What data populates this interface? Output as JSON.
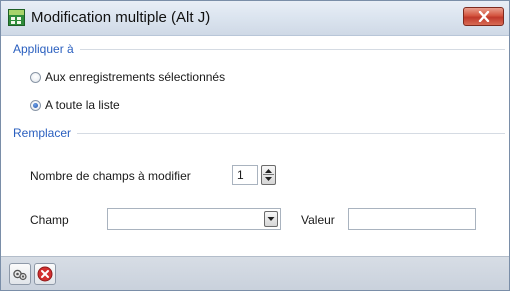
{
  "window": {
    "title": "Modification multiple (Alt J)"
  },
  "apply_group": {
    "title": "Appliquer à",
    "options": [
      {
        "label": "Aux enregistrements sélectionnés",
        "checked": false
      },
      {
        "label": "A toute la liste",
        "checked": true
      }
    ]
  },
  "replace_group": {
    "title": "Remplacer",
    "field_count_label": "Nombre de champs à modifier",
    "field_count_value": "1",
    "champ_label": "Champ",
    "champ_value": "",
    "valeur_label": "Valeur",
    "valeur_value": ""
  },
  "footer": {
    "buttons": [
      {
        "icon": "run-icon"
      },
      {
        "icon": "cancel-icon"
      }
    ]
  },
  "colors": {
    "group_title": "#2a5fbf",
    "close_button": "#c0392b",
    "footer_bg": "#cfd6df"
  }
}
